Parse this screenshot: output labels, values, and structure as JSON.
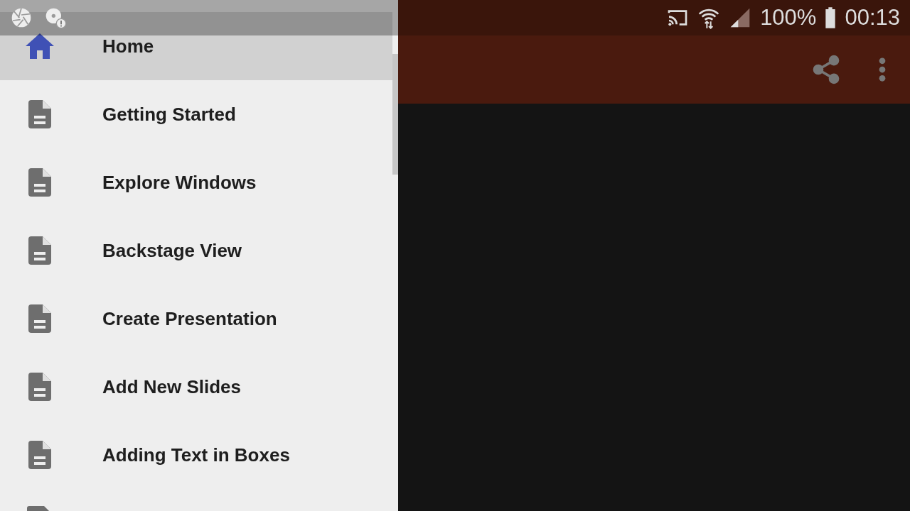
{
  "status_bar": {
    "battery": "100%",
    "time": "00:13"
  },
  "drawer": {
    "items": [
      {
        "label": "Home",
        "kind": "home",
        "selected": true
      },
      {
        "label": "Getting Started",
        "kind": "page",
        "selected": false
      },
      {
        "label": "Explore Windows",
        "kind": "page",
        "selected": false
      },
      {
        "label": "Backstage View",
        "kind": "page",
        "selected": false
      },
      {
        "label": "Create Presentation",
        "kind": "page",
        "selected": false
      },
      {
        "label": "Add New Slides",
        "kind": "page",
        "selected": false
      },
      {
        "label": "Adding Text in Boxes",
        "kind": "page",
        "selected": false
      }
    ]
  }
}
